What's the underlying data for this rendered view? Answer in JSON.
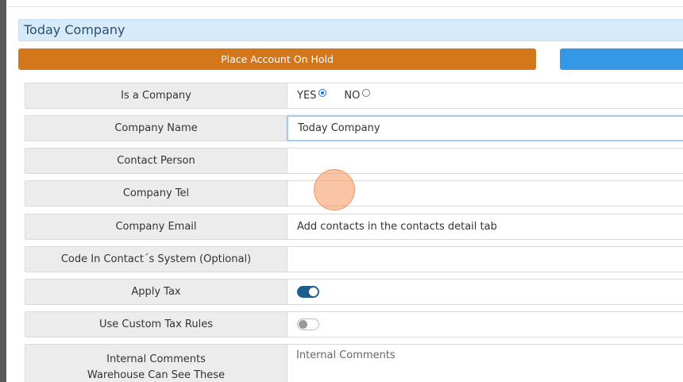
{
  "header": {
    "title": "Today Company"
  },
  "actions": {
    "hold_label": "Place Account On Hold",
    "secondary_label": ""
  },
  "form": {
    "is_company": {
      "label": "Is a Company",
      "yes": "YES",
      "no": "NO",
      "selected": "YES"
    },
    "company_name": {
      "label": "Company Name",
      "value": "Today Company"
    },
    "contact_person": {
      "label": "Contact Person",
      "value": ""
    },
    "company_tel": {
      "label": "Company Tel",
      "value": ""
    },
    "company_email": {
      "label": "Company Email",
      "value": "Add contacts in the contacts detail tab"
    },
    "code_in_contact_system": {
      "label": "Code In Contact´s System (Optional)",
      "value": ""
    },
    "apply_tax": {
      "label": "Apply Tax",
      "enabled": true
    },
    "custom_tax_rules": {
      "label": "Use Custom Tax Rules",
      "enabled": false
    },
    "internal_comments": {
      "label_line1": "Internal Comments",
      "label_line2": "Warehouse Can See These",
      "placeholder": "Internal Comments"
    }
  },
  "colors": {
    "title_bg": "#d6eaf9",
    "hold_button": "#d4761a",
    "secondary_button": "#3598e6",
    "toggle_on": "#1e5f8e",
    "click_indicator": "#f6965a"
  }
}
